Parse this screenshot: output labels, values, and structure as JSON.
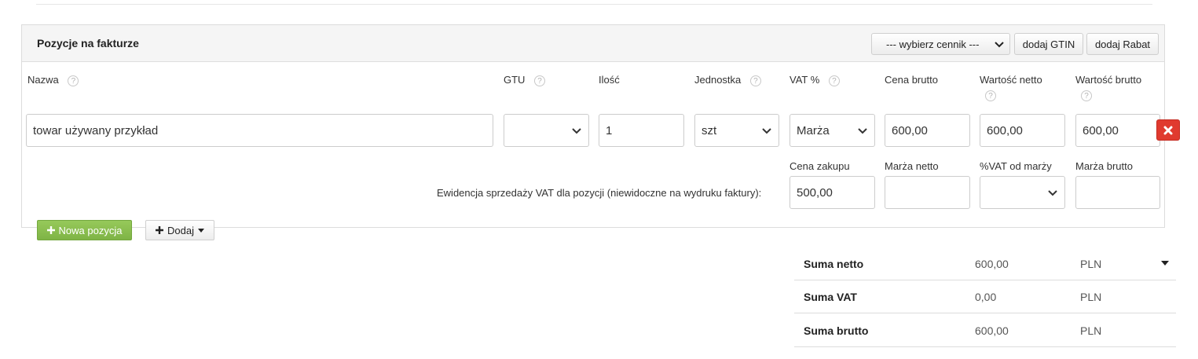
{
  "panel": {
    "title": "Pozycje na fakturze",
    "pricelist_select": "--- wybierz cennik ---",
    "add_gtin_label": "dodaj GTIN",
    "add_discount_label": "dodaj Rabat"
  },
  "columns": {
    "name": "Nazwa",
    "gtu": "GTU",
    "quantity": "Ilość",
    "unit": "Jednostka",
    "vat": "VAT %",
    "gross_price": "Cena brutto",
    "net_value": "Wartość netto",
    "gross_value": "Wartość brutto"
  },
  "help_glyph": "?",
  "item": {
    "name": "towar używany przykład",
    "gtu": "",
    "quantity": "1",
    "unit": "szt",
    "vat": "Marża",
    "gross_price": "600,00",
    "net_value": "600,00",
    "gross_value": "600,00"
  },
  "margin": {
    "label": "Ewidencja sprzedaży VAT dla pozycji (niewidoczne na wydruku faktury):",
    "purchase_price_label": "Cena zakupu",
    "net_margin_label": "Marża netto",
    "vat_margin_label": "%VAT od marży",
    "gross_margin_label": "Marża brutto",
    "purchase_price": "500,00",
    "net_margin": "",
    "vat_margin": "",
    "gross_margin": ""
  },
  "actions": {
    "new_item_label": "Nowa pozycja",
    "add_label": "Dodaj"
  },
  "summary": [
    {
      "label": "Suma netto",
      "value": "600,00",
      "currency": "PLN"
    },
    {
      "label": "Suma VAT",
      "value": "0,00",
      "currency": "PLN"
    },
    {
      "label": "Suma brutto",
      "value": "600,00",
      "currency": "PLN"
    }
  ],
  "icons": {
    "help": "question-circle-icon",
    "delete": "times-icon",
    "plus": "plus-icon",
    "dropdown": "chevron-down-icon"
  },
  "colors": {
    "danger": "#e03a2f",
    "success": "#8dc152",
    "header_bg": "#f5f5f5"
  }
}
